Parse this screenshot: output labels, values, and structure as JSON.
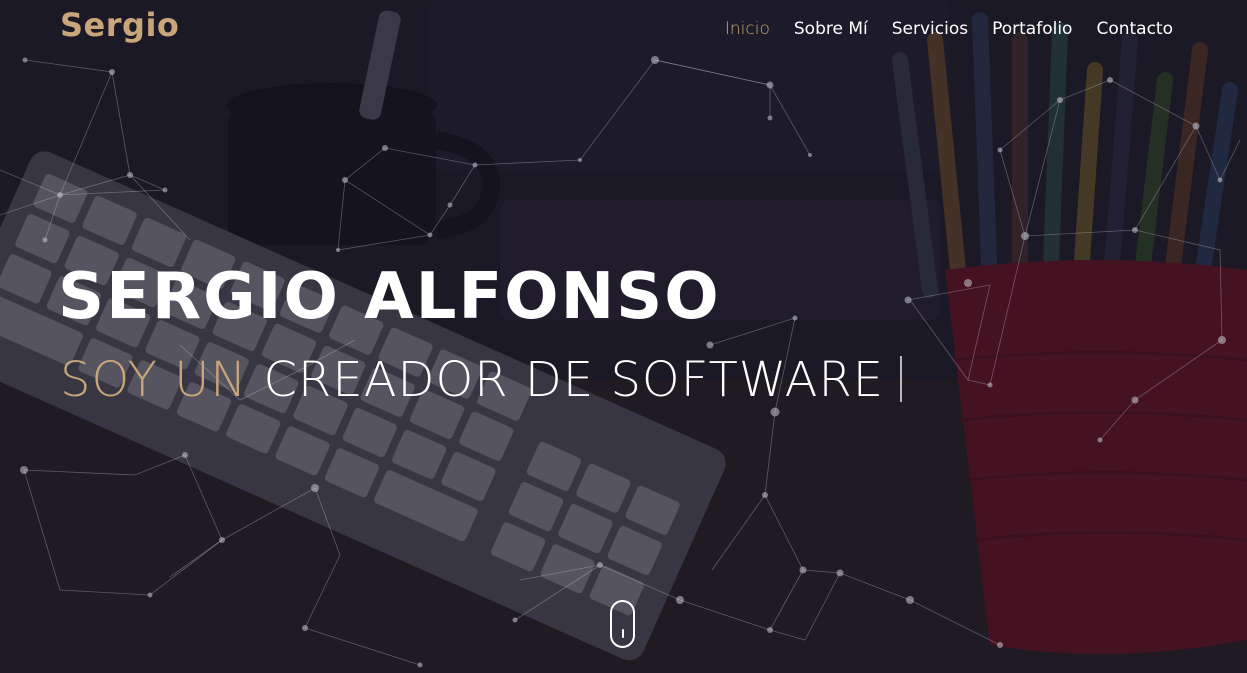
{
  "navbar": {
    "brand": "Sergio",
    "links": [
      {
        "label": "Inicio",
        "active": true
      },
      {
        "label": "Sobre Mí",
        "active": false
      },
      {
        "label": "Servicios",
        "active": false
      },
      {
        "label": "Portafolio",
        "active": false
      },
      {
        "label": "Contacto",
        "active": false
      }
    ]
  },
  "hero": {
    "title": "SERGIO ALFONSO",
    "subtitle_prefix": "SOY UN",
    "subtitle_typed": "CREADOR DE SOFTWARE"
  },
  "scroll_indicator": {
    "icon": "mouse-scroll-icon"
  },
  "colors": {
    "accent": "#c9a57a",
    "text": "#ffffff",
    "background": "#1d1a26"
  }
}
